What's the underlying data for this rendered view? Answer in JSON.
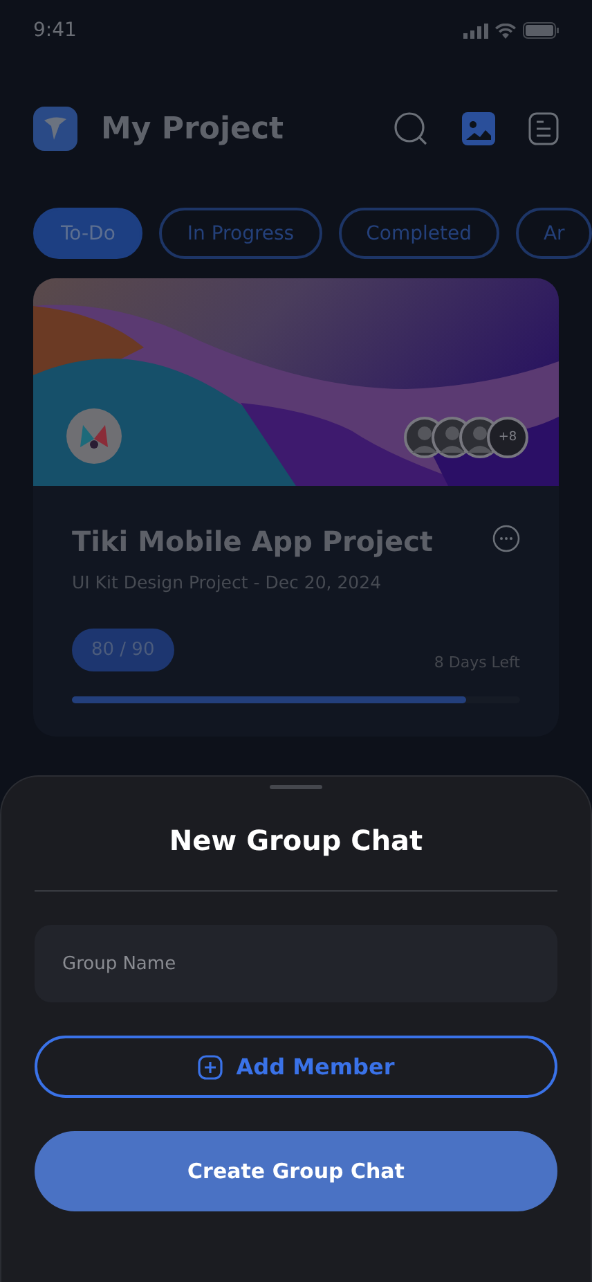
{
  "status_bar": {
    "time": "9:41"
  },
  "header": {
    "title": "My Project"
  },
  "tabs": [
    {
      "label": "To-Do",
      "selected": true
    },
    {
      "label": "In Progress",
      "selected": false
    },
    {
      "label": "Completed",
      "selected": false
    },
    {
      "label": "Ar",
      "selected": false
    }
  ],
  "project_card": {
    "extra_members": "+8",
    "title": "Tiki Mobile App Project",
    "subtitle": "UI Kit Design Project - Dec 20, 2024",
    "score": "80 / 90",
    "days_left": "8 Days Left",
    "level": 0.88
  },
  "sheet": {
    "title": "New Group Chat",
    "group_name": {
      "placeholder": "Group Name"
    },
    "add_button": "Add Member",
    "create_button": "Create Group Chat"
  }
}
